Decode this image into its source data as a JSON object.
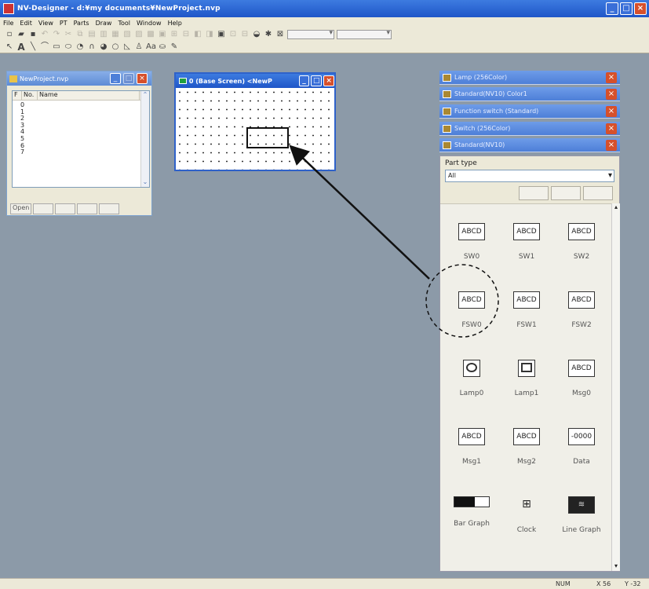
{
  "window": {
    "title": "NV-Designer - d:¥my documents¥NewProject.nvp"
  },
  "menu": [
    "File",
    "Edit",
    "View",
    "PT",
    "Parts",
    "Draw",
    "Tool",
    "Window",
    "Help"
  ],
  "project": {
    "title": "NewProject.nvp",
    "columns": [
      "F",
      "No.",
      "Name"
    ],
    "rows": [
      "0",
      "1",
      "2",
      "3",
      "4",
      "5",
      "6",
      "7"
    ],
    "open_label": "Open"
  },
  "base_screen": {
    "title": "0 (Base Screen) <NewP"
  },
  "palettes": [
    "Lamp (256Color)",
    "Standard(NV10) Color1",
    "Function switch (Standard)",
    "Switch (256Color)",
    "Standard(NV10)"
  ],
  "parts_panel": {
    "part_type_label": "Part type",
    "part_type_value": "All",
    "items": [
      {
        "label": "SW0",
        "icon": "ABCD"
      },
      {
        "label": "SW1",
        "icon": "ABCD"
      },
      {
        "label": "SW2",
        "icon": "ABCD"
      },
      {
        "label": "FSW0",
        "icon": "ABCD"
      },
      {
        "label": "FSW1",
        "icon": "ABCD"
      },
      {
        "label": "FSW2",
        "icon": "ABCD"
      },
      {
        "label": "Lamp0",
        "icon": "circle-lamp-icon"
      },
      {
        "label": "Lamp1",
        "icon": "square-lamp-icon"
      },
      {
        "label": "Msg0",
        "icon": "ABCD"
      },
      {
        "label": "Msg1",
        "icon": "ABCD"
      },
      {
        "label": "Msg2",
        "icon": "ABCD"
      },
      {
        "label": "Data",
        "icon": "-0000"
      },
      {
        "label": "Bar Graph",
        "icon": "bar-graph-icon"
      },
      {
        "label": "Clock",
        "icon": "clock-icon"
      },
      {
        "label": "Line Graph",
        "icon": "line-graph-icon"
      }
    ]
  },
  "status": {
    "mode": "NUM",
    "x": "X 56",
    "y": "Y -32"
  }
}
